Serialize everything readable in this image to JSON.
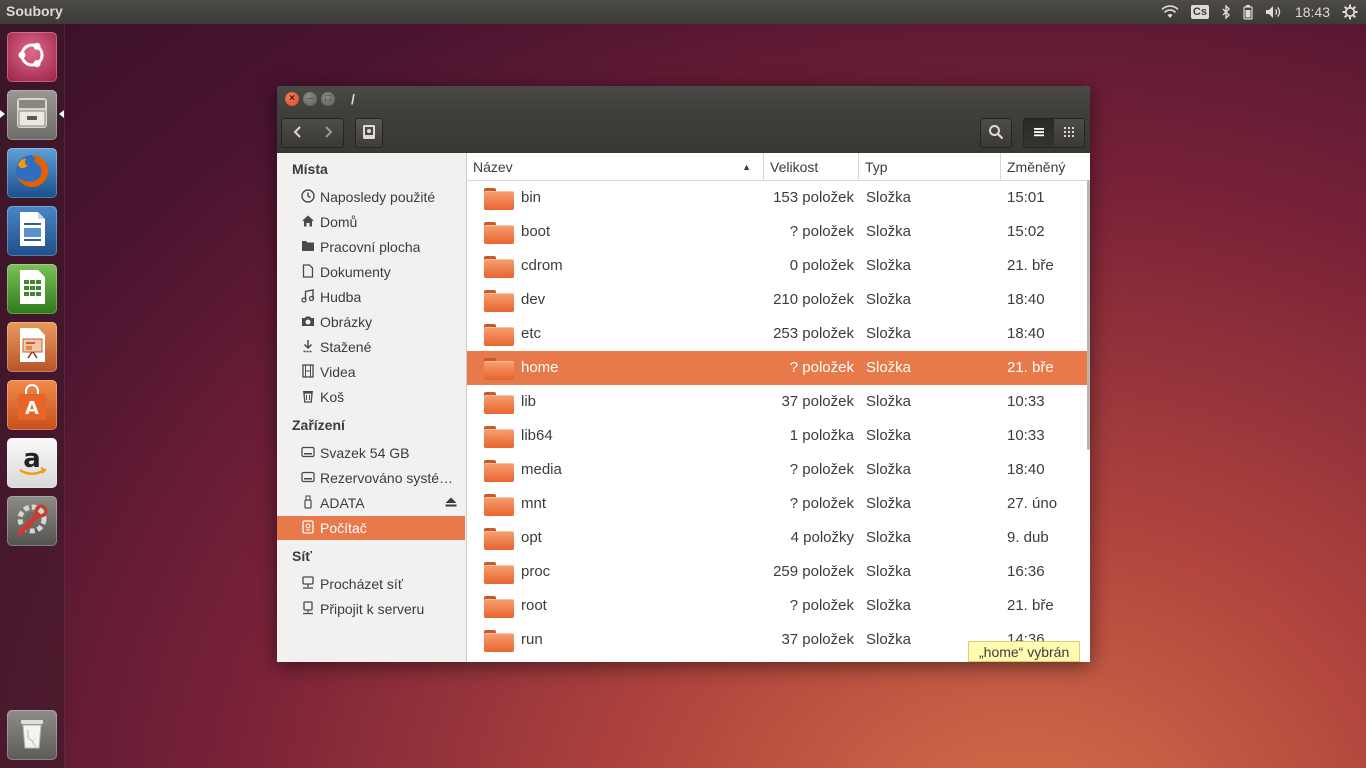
{
  "topbar": {
    "app_title": "Soubory",
    "keyboard_layout": "Cs",
    "clock": "18:43"
  },
  "launcher": {
    "items": [
      {
        "name": "ubuntu-dash",
        "icon": "ubuntu-logo-icon"
      },
      {
        "name": "files",
        "icon": "file-cabinet-icon",
        "active": true
      },
      {
        "name": "firefox",
        "icon": "firefox-icon"
      },
      {
        "name": "libreoffice-writer",
        "icon": "writer-icon"
      },
      {
        "name": "libreoffice-calc",
        "icon": "calc-icon"
      },
      {
        "name": "libreoffice-impress",
        "icon": "impress-icon"
      },
      {
        "name": "software-center",
        "icon": "shopping-bag-icon"
      },
      {
        "name": "amazon",
        "icon": "amazon-icon"
      },
      {
        "name": "system-settings",
        "icon": "settings-wrench-icon"
      },
      {
        "name": "trash",
        "icon": "trash-icon"
      }
    ]
  },
  "window": {
    "title": "/",
    "sidebar": {
      "sections": {
        "places": "Místa",
        "devices": "Zařízení",
        "network": "Síť"
      },
      "places": [
        {
          "label": "Naposledy použité",
          "icon": "clock-icon"
        },
        {
          "label": "Domů",
          "icon": "home-icon"
        },
        {
          "label": "Pracovní plocha",
          "icon": "desktop-folder-icon"
        },
        {
          "label": "Dokumenty",
          "icon": "document-icon"
        },
        {
          "label": "Hudba",
          "icon": "music-icon"
        },
        {
          "label": "Obrázky",
          "icon": "camera-icon"
        },
        {
          "label": "Stažené",
          "icon": "download-icon"
        },
        {
          "label": "Videa",
          "icon": "film-icon"
        },
        {
          "label": "Koš",
          "icon": "trash-icon"
        }
      ],
      "devices": [
        {
          "label": "Svazek 54 GB",
          "icon": "drive-icon"
        },
        {
          "label": "Rezervováno systé…",
          "icon": "drive-icon"
        },
        {
          "label": "ADATA",
          "icon": "usb-icon"
        },
        {
          "label": "Počítač",
          "icon": "computer-icon",
          "active": true
        }
      ],
      "network": [
        {
          "label": "Procházet síť",
          "icon": "network-icon"
        },
        {
          "label": "Připojit k serveru",
          "icon": "server-icon"
        }
      ]
    },
    "columns": {
      "name": "Název",
      "size": "Velikost",
      "type": "Typ",
      "modified": "Změněný"
    },
    "files": [
      {
        "name": "bin",
        "size": "153 položek",
        "type": "Složka",
        "modified": "15:01"
      },
      {
        "name": "boot",
        "size": "? položek",
        "type": "Složka",
        "modified": "15:02"
      },
      {
        "name": "cdrom",
        "size": "0 položek",
        "type": "Složka",
        "modified": "21. bře"
      },
      {
        "name": "dev",
        "size": "210 položek",
        "type": "Složka",
        "modified": "18:40"
      },
      {
        "name": "etc",
        "size": "253 položek",
        "type": "Složka",
        "modified": "18:40"
      },
      {
        "name": "home",
        "size": "? položek",
        "type": "Složka",
        "modified": "21. bře",
        "selected": true
      },
      {
        "name": "lib",
        "size": "37 položek",
        "type": "Složka",
        "modified": "10:33"
      },
      {
        "name": "lib64",
        "size": "1 položka",
        "type": "Složka",
        "modified": "10:33"
      },
      {
        "name": "media",
        "size": "? položek",
        "type": "Složka",
        "modified": "18:40"
      },
      {
        "name": "mnt",
        "size": "? položek",
        "type": "Složka",
        "modified": "27. úno"
      },
      {
        "name": "opt",
        "size": "4 položky",
        "type": "Složka",
        "modified": "9. dub"
      },
      {
        "name": "proc",
        "size": "259 položek",
        "type": "Složka",
        "modified": "16:36"
      },
      {
        "name": "root",
        "size": "? položek",
        "type": "Složka",
        "modified": "21. bře"
      },
      {
        "name": "run",
        "size": "37 položek",
        "type": "Složka",
        "modified": "14:36"
      }
    ],
    "status": "„home“ vybrán",
    "accent_color": "#e8794b"
  }
}
